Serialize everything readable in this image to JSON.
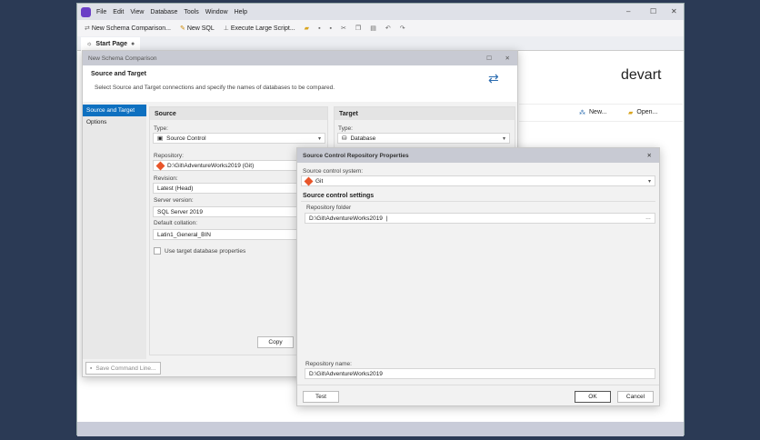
{
  "menu": [
    "File",
    "Edit",
    "View",
    "Database",
    "Tools",
    "Window",
    "Help"
  ],
  "toolbar": {
    "new_schema": "New Schema Comparison...",
    "new_sql": "New SQL",
    "execute": "Execute Large Script..."
  },
  "tab": {
    "label": "Start Page"
  },
  "start": {
    "logo": "devart",
    "new": "New...",
    "open": "Open..."
  },
  "nsc": {
    "title": "New Schema Comparison",
    "heading": "Source and Target",
    "desc": "Select Source and Target connections and specify the names of databases to be compared.",
    "nav": [
      "Source and Target",
      "Options"
    ],
    "source": {
      "title": "Source",
      "type_label": "Type:",
      "type": "Source Control",
      "repo_label": "Repository:",
      "repo": "D:\\Git\\AdventureWorks2019 (Git)",
      "rev_label": "Revision:",
      "rev": "Latest (Head)",
      "server_label": "Server version:",
      "server": "SQL Server 2019",
      "coll_label": "Default collation:",
      "coll": "Latin1_General_BIN",
      "use_target": "Use target database properties",
      "copy": "Copy"
    },
    "target": {
      "title": "Target",
      "type_label": "Type:",
      "type": "Database"
    },
    "save_cmd": "Save Command Line..."
  },
  "scr": {
    "title": "Source Control Repository Properties",
    "sys_label": "Source control system:",
    "sys": "Git",
    "settings": "Source control settings",
    "folder_label": "Repository folder",
    "folder": "D:\\Git\\AdventureWorks2019",
    "name_label": "Repository name:",
    "name": "D:\\Git\\AdventureWorks2019",
    "test": "Test",
    "ok": "OK",
    "cancel": "Cancel"
  }
}
